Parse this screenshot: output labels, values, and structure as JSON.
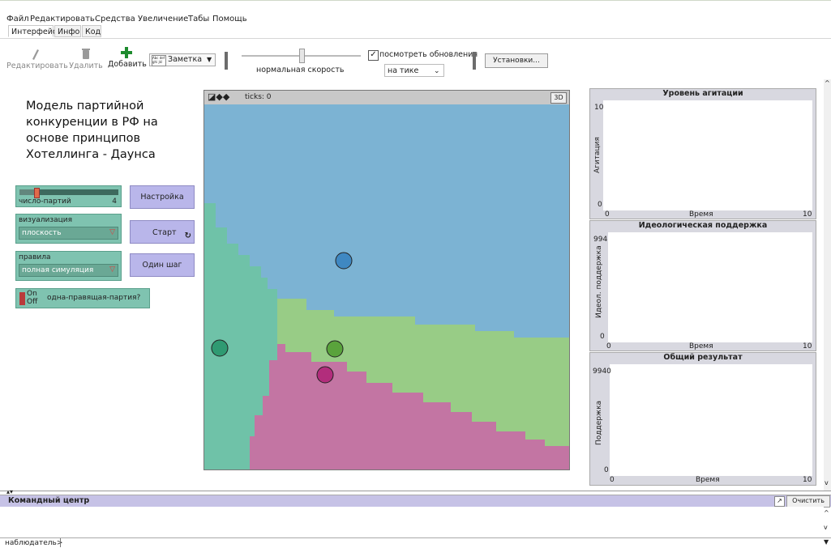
{
  "menu": [
    "Файл",
    "Редактировать",
    "Средства",
    "Увеличение",
    "Табы",
    "Помощь"
  ],
  "tabs": [
    "Интерфейс",
    "Инфо",
    "Код"
  ],
  "toolbar": {
    "edit_label": "Редактировать",
    "delete_label": "Удалить",
    "add_label": "Добавить",
    "note_icon_text": "Abc def ghi jkl",
    "note_select": "Заметка",
    "speed_label": "нормальная скорость",
    "speed_level": 0.5,
    "updates_label": "посмотреть обновления",
    "updates_checked": true,
    "update_mode": "на тике",
    "settings_label": "Установки..."
  },
  "model_title": "Модель партийной конкуренции в РФ на основе принципов Хотеллинга - Даунса",
  "widgets": {
    "slider_label": "число-партий",
    "slider_value": "4",
    "slider_fraction": 0.3,
    "chooser1_label": "визуализация",
    "chooser1_value": "плоскость",
    "chooser2_label": "правила",
    "chooser2_value": "полная симуляция",
    "switch_on": "On",
    "switch_off": "Off",
    "switch_label": "одна-правящая-партия?",
    "setup_button": "Настройка",
    "go_button": "Старт",
    "step_button": "Один шаг"
  },
  "view": {
    "ticks_label": "ticks: 0",
    "three_d": "3D",
    "colors": {
      "blue": "#7cb3d3",
      "teal": "#6fc2a8",
      "green": "#98cc86",
      "pink": "#c375a3"
    },
    "agents": [
      {
        "name": "blue-agent",
        "color": "#3f88c2"
      },
      {
        "name": "teal-agent",
        "color": "#2f9a72"
      },
      {
        "name": "green-agent",
        "color": "#5aa33c"
      },
      {
        "name": "magenta-agent",
        "color": "#b22d7c"
      }
    ]
  },
  "plots": [
    {
      "title": "Уровень агитации",
      "ylabel": "Агитация",
      "xlabel": "Время",
      "ymax": "10",
      "ymin": "0",
      "xmin": "0",
      "xmax": "10"
    },
    {
      "title": "Идеологическая поддержка",
      "ylabel": "Идеол. поддержка",
      "xlabel": "Время",
      "ymax": "994",
      "ymin": "0",
      "xmin": "0",
      "xmax": "10"
    },
    {
      "title": "Общий результат",
      "ylabel": "Поддержка",
      "xlabel": "Время",
      "ymax": "9940",
      "ymin": "0",
      "xmin": "0",
      "xmax": "10"
    }
  ],
  "command_center": {
    "title": "Командный центр",
    "clear_label": "Очистить",
    "prompt": "наблюдатель>"
  }
}
